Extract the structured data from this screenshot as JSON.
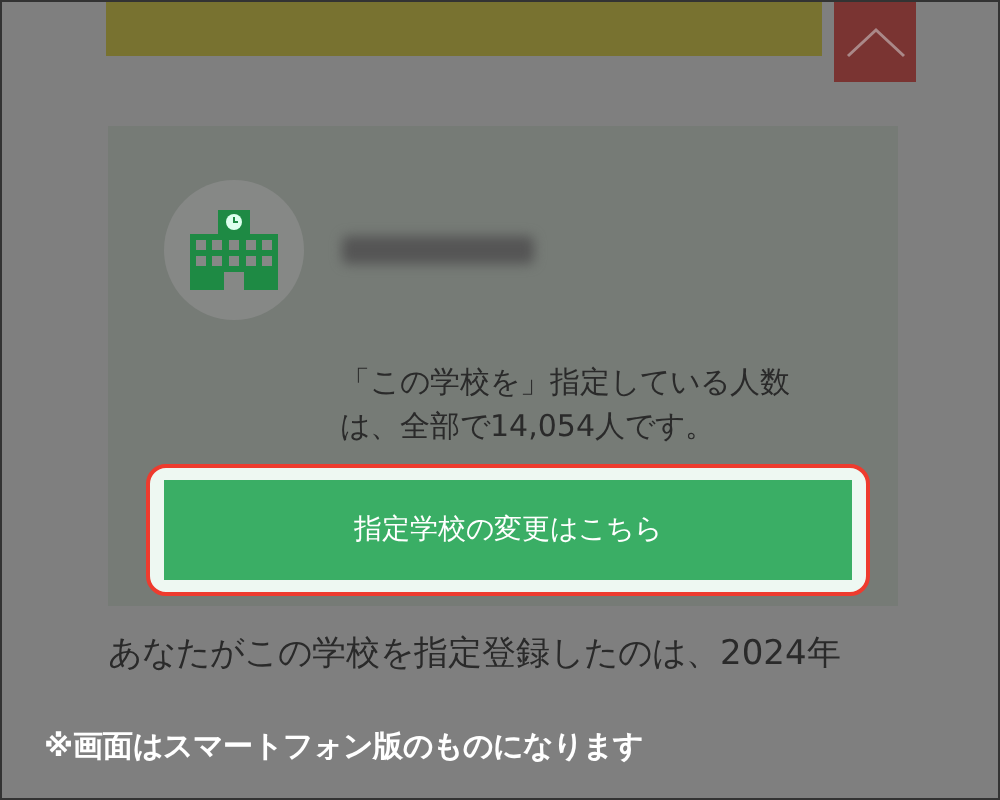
{
  "school_card": {
    "count_text": "「この学校を」指定している人数は、全部で14,054人です。",
    "change_button": {
      "label": "指定学校の変更はこちら",
      "highlighted": true
    }
  },
  "registration_text": "あなたがこの学校を指定登録したのは、2024年",
  "caption": "※画面はスマートフォン版のものになります"
}
